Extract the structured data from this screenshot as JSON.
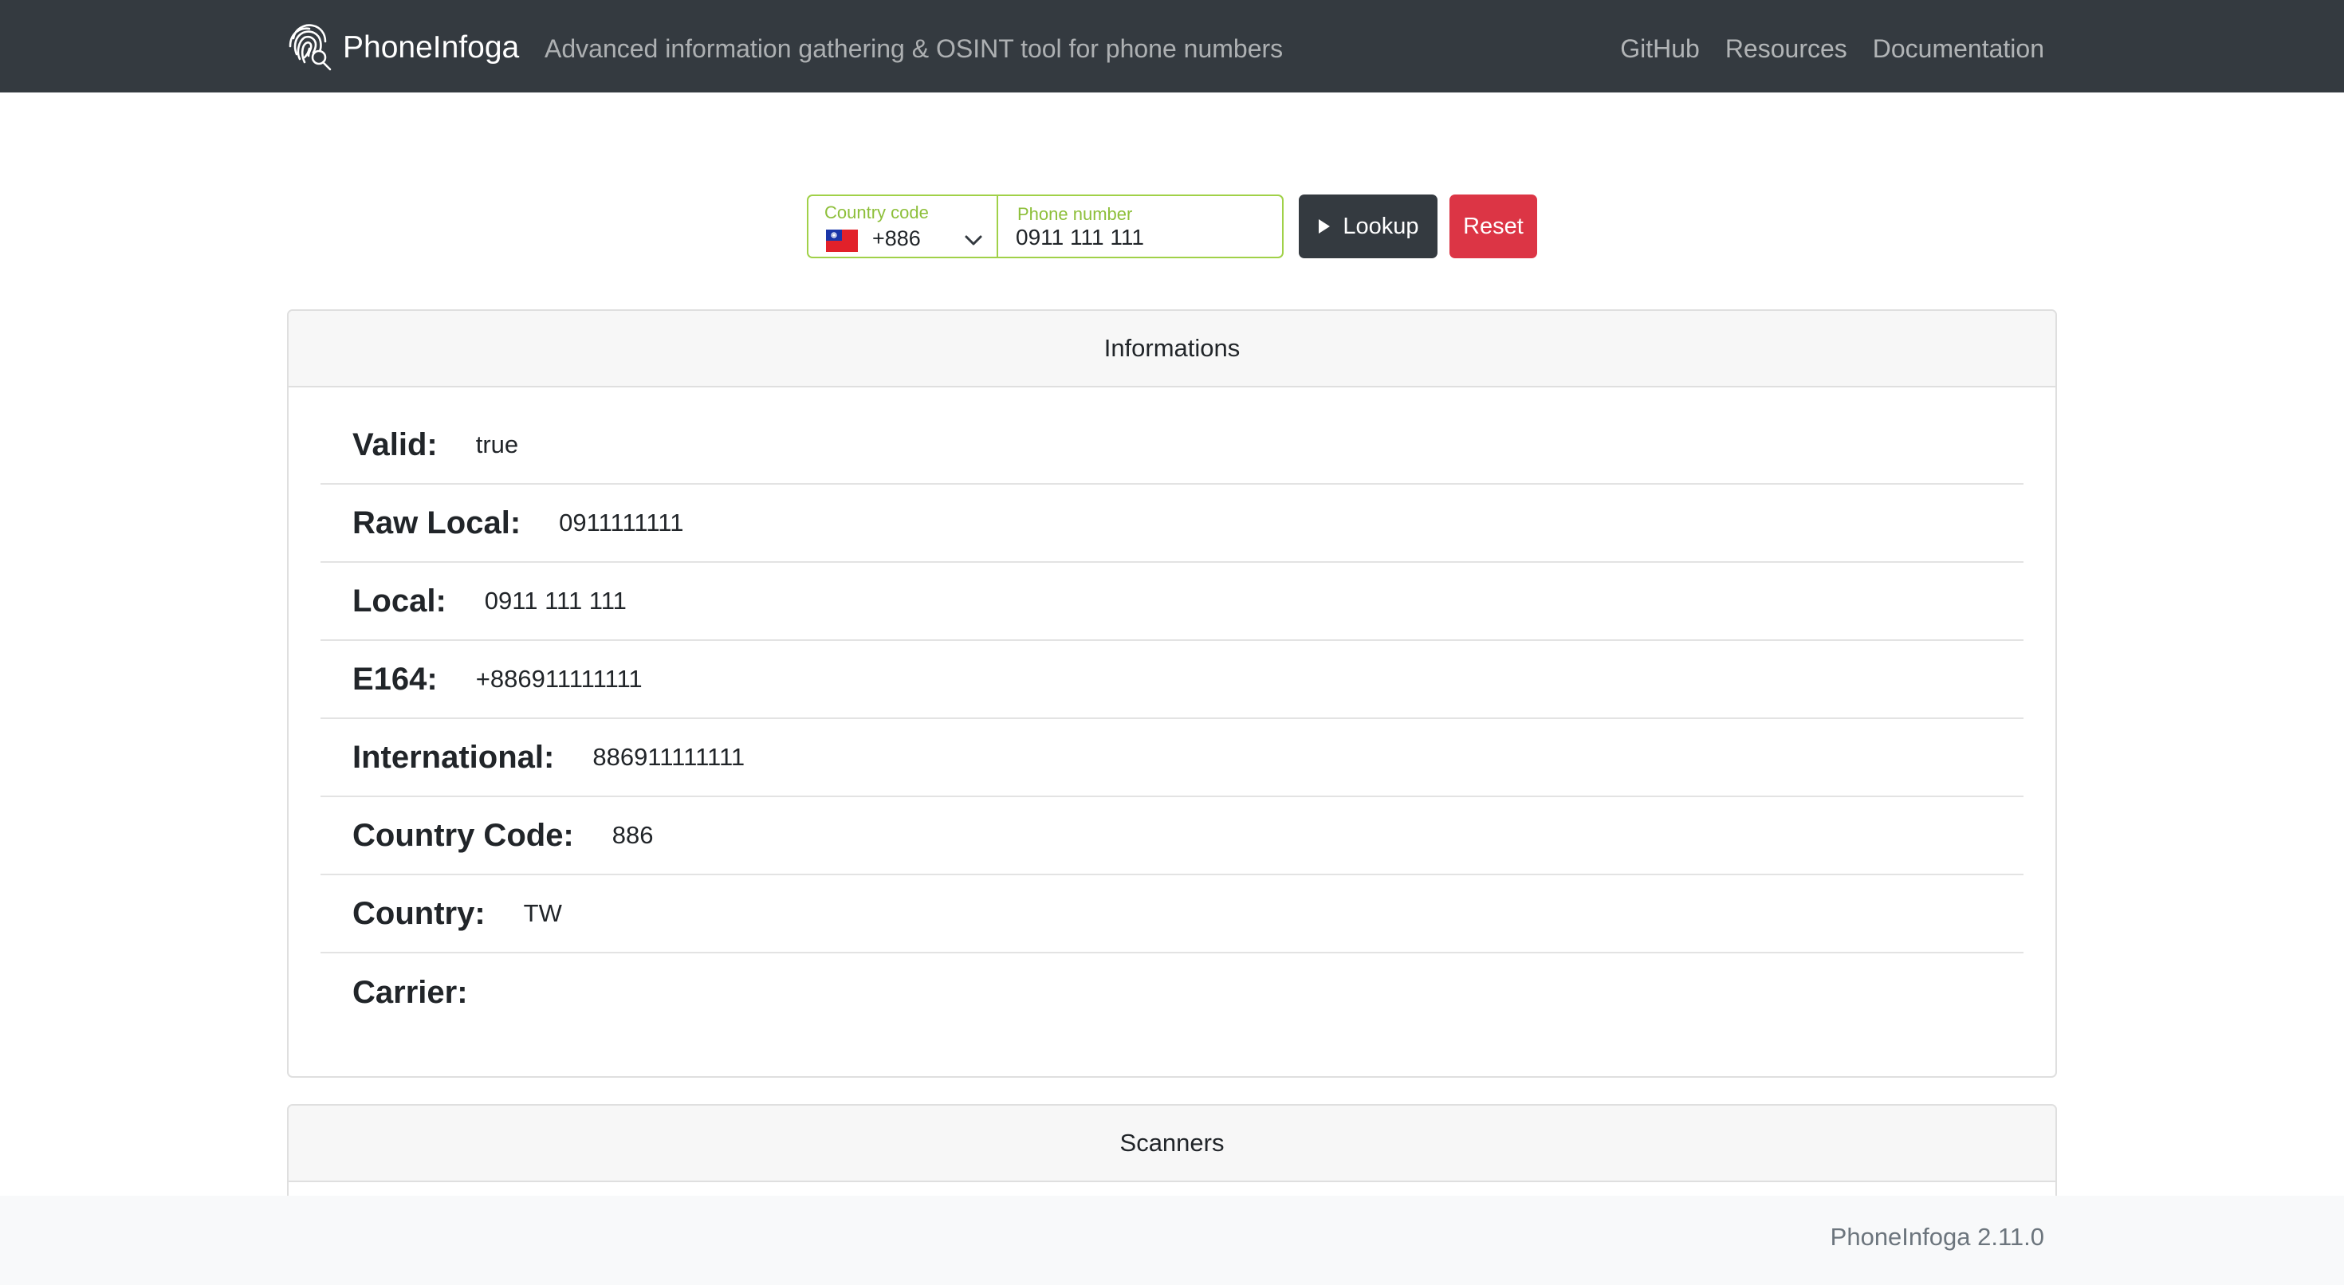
{
  "navbar": {
    "brand": "PhoneInfoga",
    "tagline": "Advanced information gathering & OSINT tool for phone numbers",
    "links": [
      "GitHub",
      "Resources",
      "Documentation"
    ]
  },
  "search": {
    "country_label": "Country code",
    "country_value": "+886",
    "country_flag": "taiwan-flag-icon",
    "phone_label": "Phone number",
    "phone_value": "0911 111 111",
    "lookup_label": "Lookup",
    "reset_label": "Reset",
    "accent_color": "#a0d148"
  },
  "info": {
    "title": "Informations",
    "rows": [
      {
        "key": "Valid:",
        "value": "true"
      },
      {
        "key": "Raw Local:",
        "value": "0911111111"
      },
      {
        "key": "Local:",
        "value": "0911 111 111"
      },
      {
        "key": "E164:",
        "value": "+886911111111"
      },
      {
        "key": "International:",
        "value": "886911111111"
      },
      {
        "key": "Country Code:",
        "value": "886"
      },
      {
        "key": "Country:",
        "value": "TW"
      },
      {
        "key": "Carrier:",
        "value": ""
      }
    ]
  },
  "scanners": {
    "title": "Scanners"
  },
  "footer": {
    "version": "PhoneInfoga 2.11.0"
  },
  "colors": {
    "navbar_bg": "#343a40",
    "lookup_bg": "#343a40",
    "reset_bg": "#dc3545",
    "footer_bg": "#f8f9fa"
  }
}
